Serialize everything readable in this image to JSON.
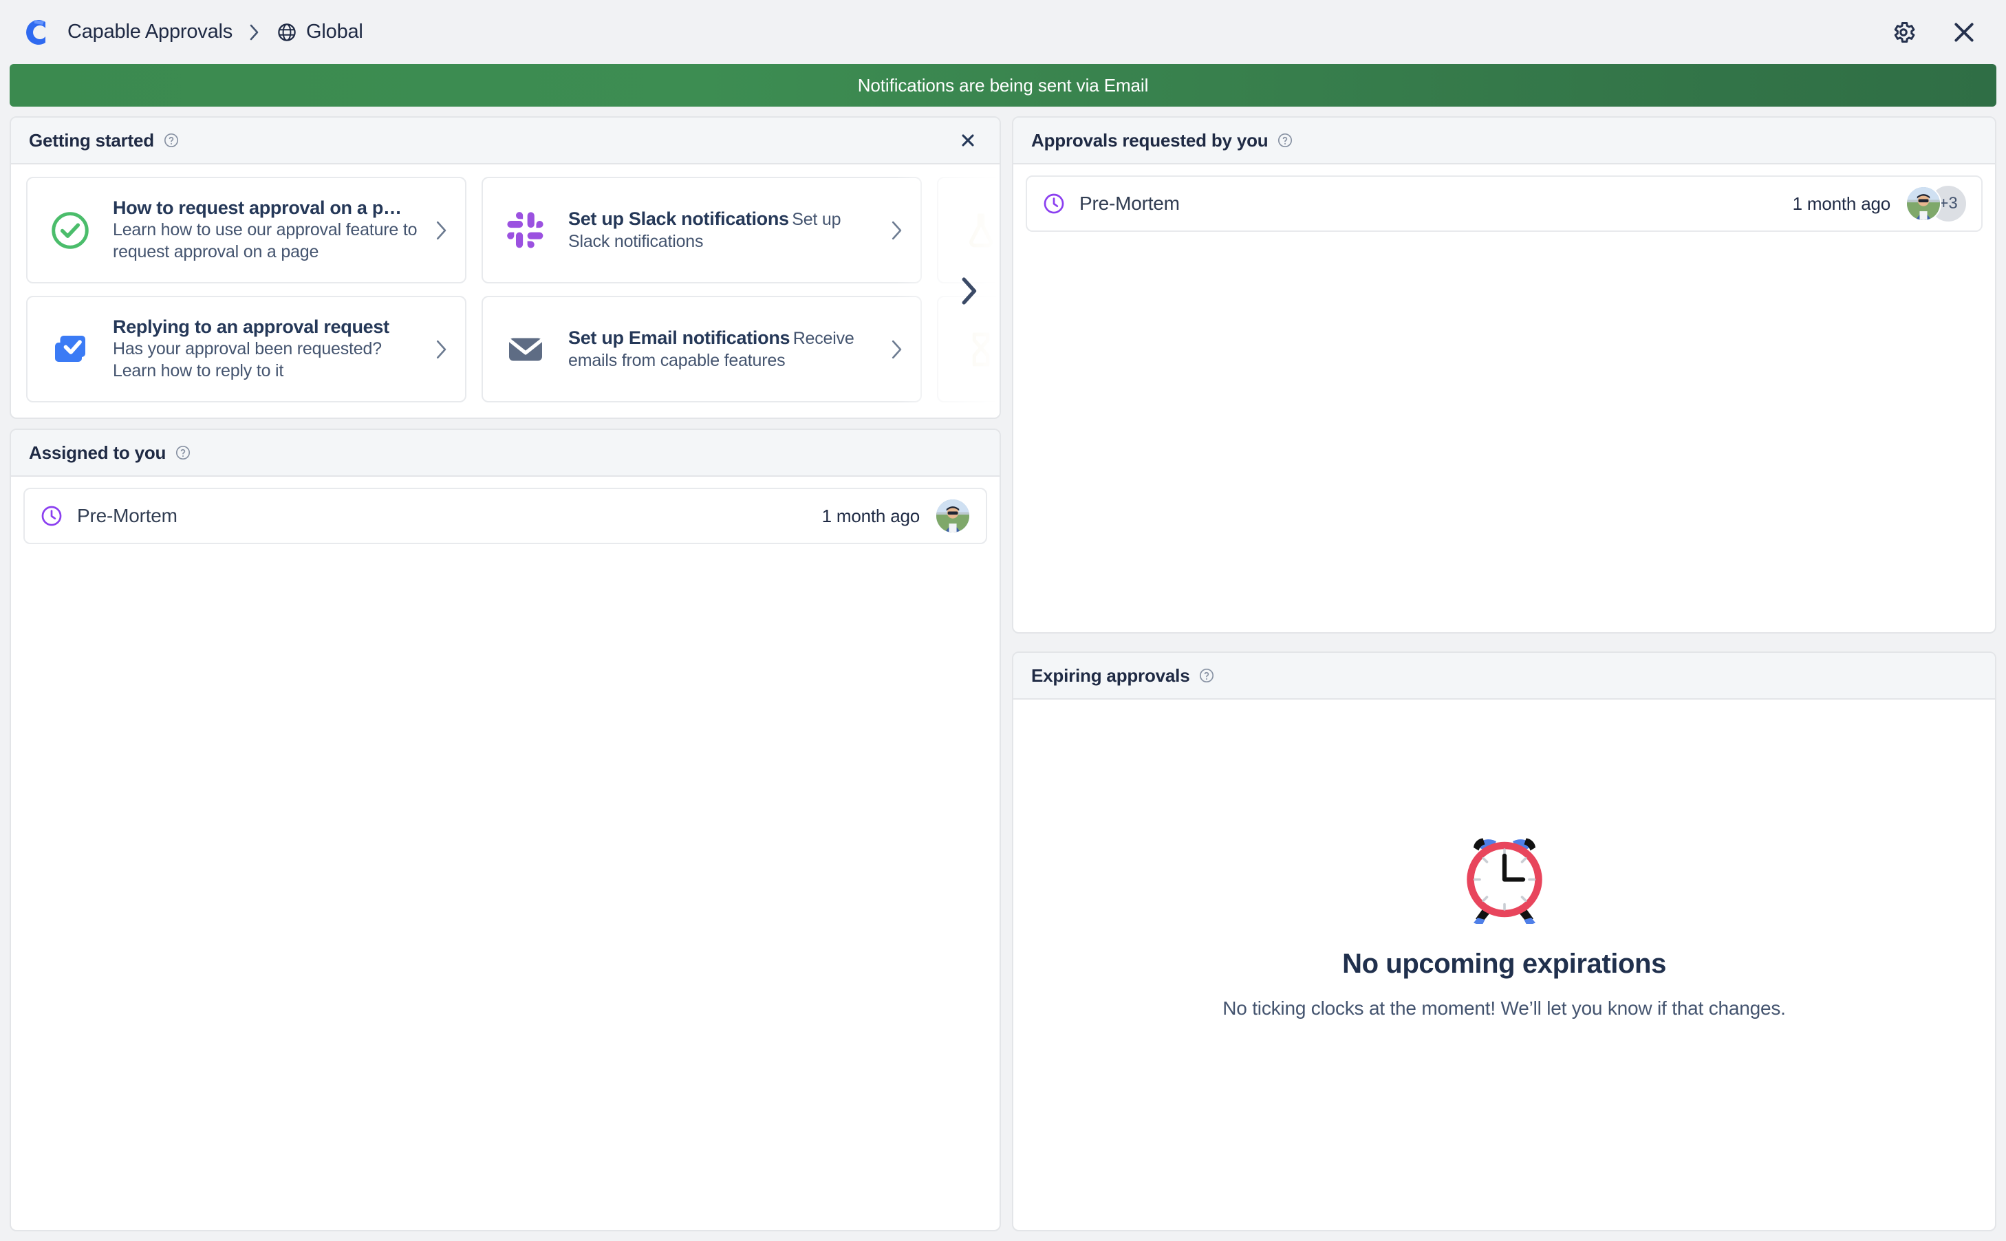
{
  "header": {
    "logo_icon": "capable-c-logo",
    "breadcrumb": [
      {
        "label": "Capable Approvals",
        "icon": null
      },
      {
        "label": "Global",
        "icon": "globe-icon"
      }
    ],
    "separator": "›",
    "settings_icon": "gear-icon",
    "close_icon": "close-icon"
  },
  "banner": {
    "message": "Notifications are being sent via Email",
    "bg_color": "#3b8a4f",
    "text_color": "#ffffff"
  },
  "getting_started": {
    "title": "Getting started",
    "help_icon": "help-circle-icon",
    "close_icon": "close-icon",
    "next_icon": "chevron-right-icon",
    "cards": [
      {
        "icon": "check-circle-icon",
        "icon_color": "#4bbd6b",
        "title": "How to request approval on a p…",
        "desc": "Learn how to use our approval feature to request approval on a page",
        "chevron": "chevron-right-icon"
      },
      {
        "icon": "slack-icon",
        "icon_color": "#9b51e0",
        "title": "Set up Slack notifications",
        "desc": "Set up Slack notifications",
        "chevron": "chevron-right-icon"
      },
      {
        "icon": "hidden-icon",
        "icon_color": "#f0e3c0",
        "title": "",
        "desc": "",
        "chevron": ""
      },
      {
        "icon": "checkbox-icon",
        "icon_color": "#3b7bf5",
        "title": "Replying to an approval request",
        "desc": "Has your approval been requested? Learn how to reply to it",
        "chevron": "chevron-right-icon"
      },
      {
        "icon": "mail-icon",
        "icon_color": "#5e6c84",
        "title": "Set up Email notifications",
        "desc": "Receive emails from capable features",
        "chevron": "chevron-right-icon"
      },
      {
        "icon": "hidden-icon",
        "icon_color": "#f0e3c0",
        "title": "",
        "desc": "",
        "chevron": ""
      }
    ]
  },
  "assigned_to_you": {
    "title": "Assigned to you",
    "help_icon": "help-circle-icon",
    "rows": [
      {
        "icon": "clock-icon",
        "icon_color": "#8b3ff0",
        "name": "Pre-Mortem",
        "time": "1 month ago",
        "avatar_count": 1,
        "avatar_more": ""
      }
    ]
  },
  "approvals_requested_by_you": {
    "title": "Approvals requested by you",
    "help_icon": "help-circle-icon",
    "rows": [
      {
        "icon": "clock-icon",
        "icon_color": "#8b3ff0",
        "name": "Pre-Mortem",
        "time": "1 month ago",
        "avatar_count": 1,
        "avatar_more": "+3"
      }
    ]
  },
  "expiring_approvals": {
    "title": "Expiring approvals",
    "help_icon": "help-circle-icon",
    "empty_emoji": "alarm-clock-emoji",
    "empty_title": "No upcoming expirations",
    "empty_sub": "No ticking clocks at the moment! We’ll let you know if that changes."
  }
}
